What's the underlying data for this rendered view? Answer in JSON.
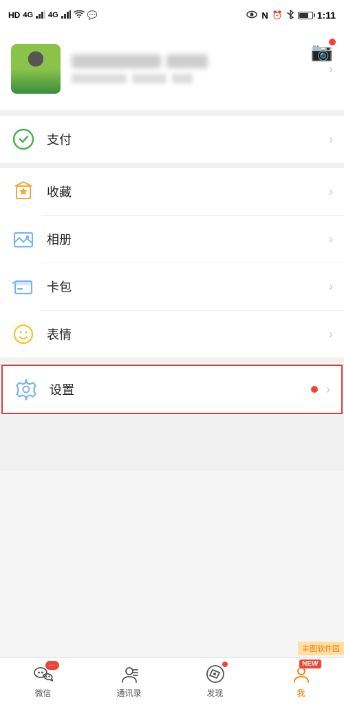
{
  "statusBar": {
    "left": "HD 4G 4G",
    "time": "1:11",
    "wifi": "WiFi",
    "bluetooth": "BT"
  },
  "camera": {
    "label": "📷"
  },
  "profile": {
    "chevron": "›"
  },
  "menuItems": [
    {
      "id": "payment",
      "label": "支付",
      "iconType": "payment",
      "highlighted": false
    },
    {
      "id": "collection",
      "label": "收藏",
      "iconType": "collection",
      "highlighted": false
    },
    {
      "id": "album",
      "label": "相册",
      "iconType": "album",
      "highlighted": false
    },
    {
      "id": "card",
      "label": "卡包",
      "iconType": "card",
      "highlighted": false
    },
    {
      "id": "emoji",
      "label": "表情",
      "iconType": "emoji",
      "highlighted": false
    },
    {
      "id": "settings",
      "label": "设置",
      "iconType": "settings",
      "highlighted": true,
      "hasDot": true
    }
  ],
  "bottomNav": [
    {
      "id": "wechat",
      "label": "微信",
      "hasBadge": true,
      "badgeText": "···"
    },
    {
      "id": "contacts",
      "label": "通讯录",
      "hasDot": false
    },
    {
      "id": "discover",
      "label": "发现",
      "hasDot": true
    },
    {
      "id": "me",
      "label": "我",
      "hasNew": true
    }
  ],
  "watermark": {
    "text": "丰图软件园"
  }
}
